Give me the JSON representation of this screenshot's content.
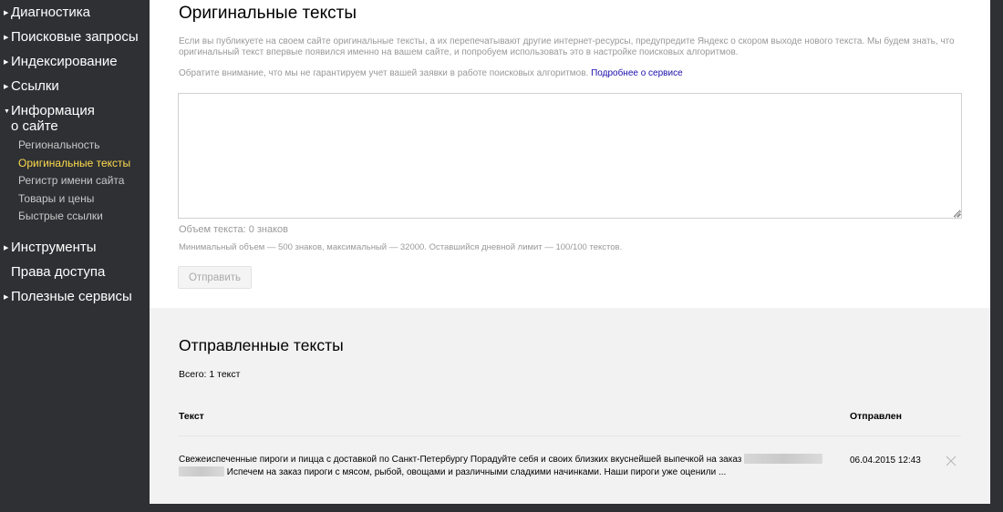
{
  "sidebar": {
    "items": [
      {
        "label": "Диагностика"
      },
      {
        "label": "Поисковые запросы"
      },
      {
        "label": "Индексирование"
      },
      {
        "label": "Ссылки"
      },
      {
        "label_line1": "Информация",
        "label_line2": "о сайте"
      },
      {
        "label": "Инструменты"
      },
      {
        "label": "Права доступа"
      },
      {
        "label": "Полезные сервисы"
      }
    ],
    "subitems": [
      {
        "label": "Региональность"
      },
      {
        "label": "Оригинальные тексты"
      },
      {
        "label": "Регистр имени сайта"
      },
      {
        "label": "Товары и цены"
      },
      {
        "label": "Быстрые ссылки"
      }
    ],
    "active_color": "#ffdb4d"
  },
  "original": {
    "title": "Оригинальные тексты",
    "description": "Если вы публикуете на своем сайте оригинальные тексты, а их перепечатывают другие интернет-ресурсы, предупредите Яндекс о скором выходе нового текста. Мы будем знать, что оригинальный текст впервые появился именно на вашем сайте, и попробуем использовать это в настройке поисковых алгоритмов.",
    "note": "Обратите внимание, что мы не гарантируем учет вашей заявки в работе поисковых алгоритмов.",
    "more_link": "Подробнее о сервисе",
    "textarea_value": "",
    "count": "Объем текста: 0 знаков",
    "limits": "Минимальный объем — 500 знаков, максимальный — 32000. Оставшийся дневной лимит — 100/100 текстов.",
    "submit_label": "Отправить"
  },
  "sent": {
    "title": "Отправленные тексты",
    "total": "Всего: 1 текст",
    "columns": {
      "text": "Текст",
      "sent": "Отправлен"
    },
    "rows": [
      {
        "text_part1": "Свежеиспеченные пироги и пицца с доставкой по Санкт-Петербургу Порадуйте себя и своих близких вкуснейшей выпечкой на заказ",
        "text_part2": "Испечем на заказ пироги с мясом, рыбой, овощами и различными сладкими начинками. Наши пироги уже оценили ...",
        "date": "06.04.2015 12:43"
      }
    ]
  }
}
